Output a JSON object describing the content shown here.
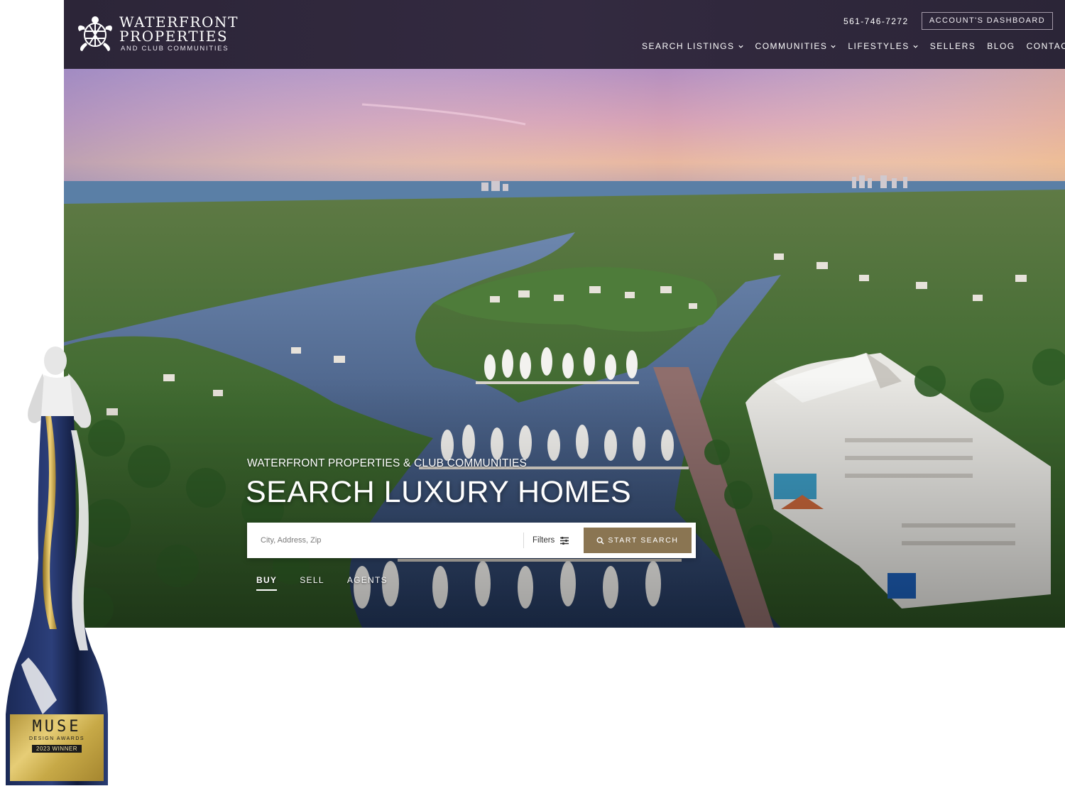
{
  "header": {
    "logo": {
      "line1": "WATERFRONT",
      "line2": "PROPERTIES",
      "line3": "AND CLUB COMMUNITIES"
    },
    "phone": "561-746-7272",
    "dashboard_label": "ACCOUNT'S DASHBOARD",
    "nav": [
      {
        "label": "SEARCH LISTINGS",
        "dropdown": true
      },
      {
        "label": "COMMUNITIES",
        "dropdown": true
      },
      {
        "label": "LIFESTYLES",
        "dropdown": true
      },
      {
        "label": "SELLERS",
        "dropdown": false
      },
      {
        "label": "BLOG",
        "dropdown": false
      },
      {
        "label": "CONTACT",
        "dropdown": false
      }
    ]
  },
  "hero": {
    "eyebrow": "WATERFRONT PROPERTIES & CLUB COMMUNITIES",
    "title": "SEARCH LUXURY HOMES",
    "search": {
      "placeholder": "City, Address, Zip",
      "value": "",
      "filters_label": "Filters",
      "button_label": "START SEARCH"
    },
    "tabs": [
      {
        "label": "BUY",
        "active": true
      },
      {
        "label": "SELL",
        "active": false
      },
      {
        "label": "AGENTS",
        "active": false
      }
    ]
  },
  "award": {
    "brand": "MUSE",
    "subtitle": "DESIGN AWARDS",
    "winner": "2023 WINNER"
  },
  "colors": {
    "header_bg": "#2c2538",
    "accent_gold": "#8a7552",
    "text_light": "#ffffff"
  },
  "icons": {
    "logo": "turtle-icon",
    "dropdown": "chevron-down-icon",
    "filters": "sliders-icon",
    "search": "search-icon"
  }
}
